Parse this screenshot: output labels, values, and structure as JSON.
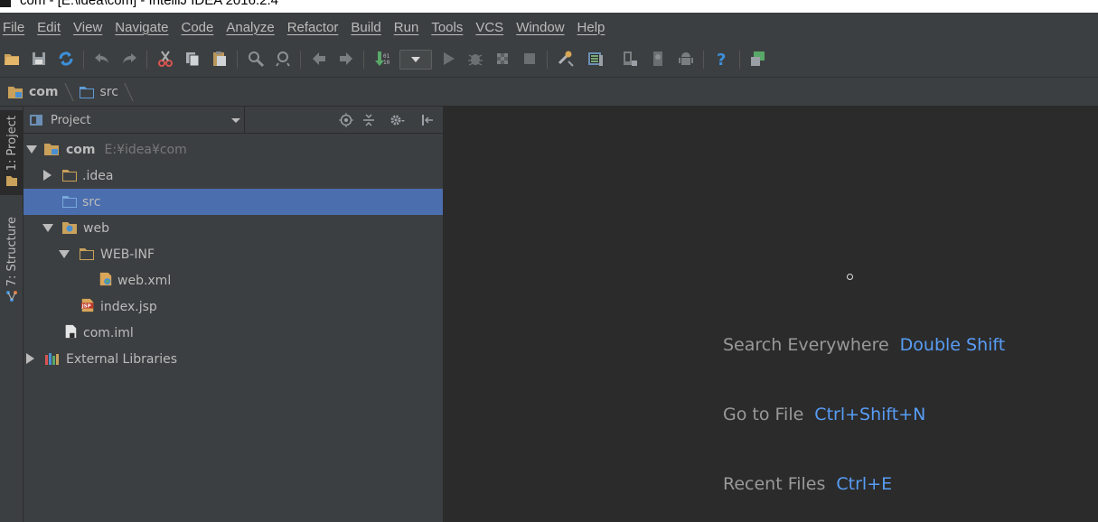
{
  "window": {
    "title": "com - [E:\\idea\\com] - IntelliJ IDEA 2016.2.4"
  },
  "menu": [
    "File",
    "Edit",
    "View",
    "Navigate",
    "Code",
    "Analyze",
    "Refactor",
    "Build",
    "Run",
    "Tools",
    "VCS",
    "Window",
    "Help"
  ],
  "toolbar": {
    "icons": [
      "open-folder-icon",
      "save-icon",
      "sync-icon",
      "undo-icon",
      "redo-icon",
      "cut-icon",
      "copy-icon",
      "paste-icon",
      "find-icon",
      "replace-icon",
      "back-icon",
      "forward-icon",
      "make-project-icon",
      "run-config-dropdown",
      "run-icon",
      "debug-icon",
      "coverage-icon",
      "stop-icon",
      "project-structure-icon",
      "sdk-manager-icon",
      "avd-manager-icon",
      "android-device-icon",
      "android-icon",
      "help-icon",
      "vcs-icon"
    ],
    "highlighted": "sdk-manager-icon"
  },
  "breadcrumbs": [
    {
      "label": "com",
      "bold": true
    },
    {
      "label": "src",
      "bold": false
    }
  ],
  "tool_tabs": {
    "project": "1: Project",
    "structure": "7: Structure"
  },
  "project_panel": {
    "view_label": "Project",
    "tree": [
      {
        "label": "com",
        "path": "E:¥idea¥com",
        "bold": true,
        "icon": "module-folder-icon",
        "expanded": true
      },
      {
        "label": ".idea",
        "icon": "folder-icon",
        "expanded": false
      },
      {
        "label": "src",
        "icon": "source-folder-icon",
        "selected": true
      },
      {
        "label": "web",
        "icon": "web-folder-icon",
        "expanded": true
      },
      {
        "label": "WEB-INF",
        "icon": "folder-icon",
        "expanded": true
      },
      {
        "label": "web.xml",
        "icon": "xml-file-icon"
      },
      {
        "label": "index.jsp",
        "icon": "jsp-file-icon"
      },
      {
        "label": "com.iml",
        "icon": "iml-file-icon"
      },
      {
        "label": "External Libraries",
        "icon": "libraries-icon",
        "expanded": false
      }
    ]
  },
  "editor_hints": [
    {
      "action": "Search Everywhere",
      "shortcut": "Double Shift"
    },
    {
      "action": "Go to File",
      "shortcut": "Ctrl+Shift+N"
    },
    {
      "action": "Recent Files",
      "shortcut": "Ctrl+E"
    }
  ],
  "colors": {
    "accent": "#589df6",
    "selection": "#4b6eaf",
    "highlight_box": "#ff0000"
  }
}
